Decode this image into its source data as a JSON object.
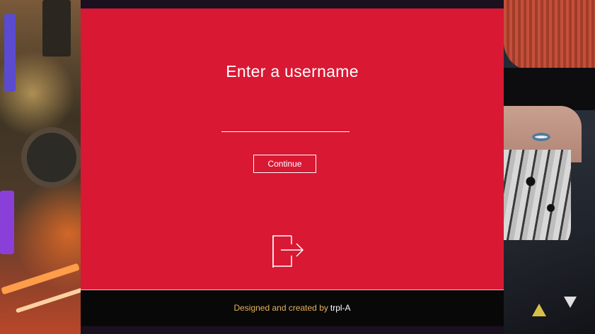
{
  "dialog": {
    "title": "Enter a username",
    "username": {
      "value": "",
      "placeholder": ""
    },
    "continue_label": "Continue",
    "signin_icon": "sign-in-arrow-icon"
  },
  "footer": {
    "credit_text": "Designed and created by",
    "author": "trpl-A"
  },
  "colors": {
    "panel": "#d91833",
    "footer_bg": "#080808",
    "footer_text": "#e7b15a",
    "foreground": "#ffffff"
  }
}
